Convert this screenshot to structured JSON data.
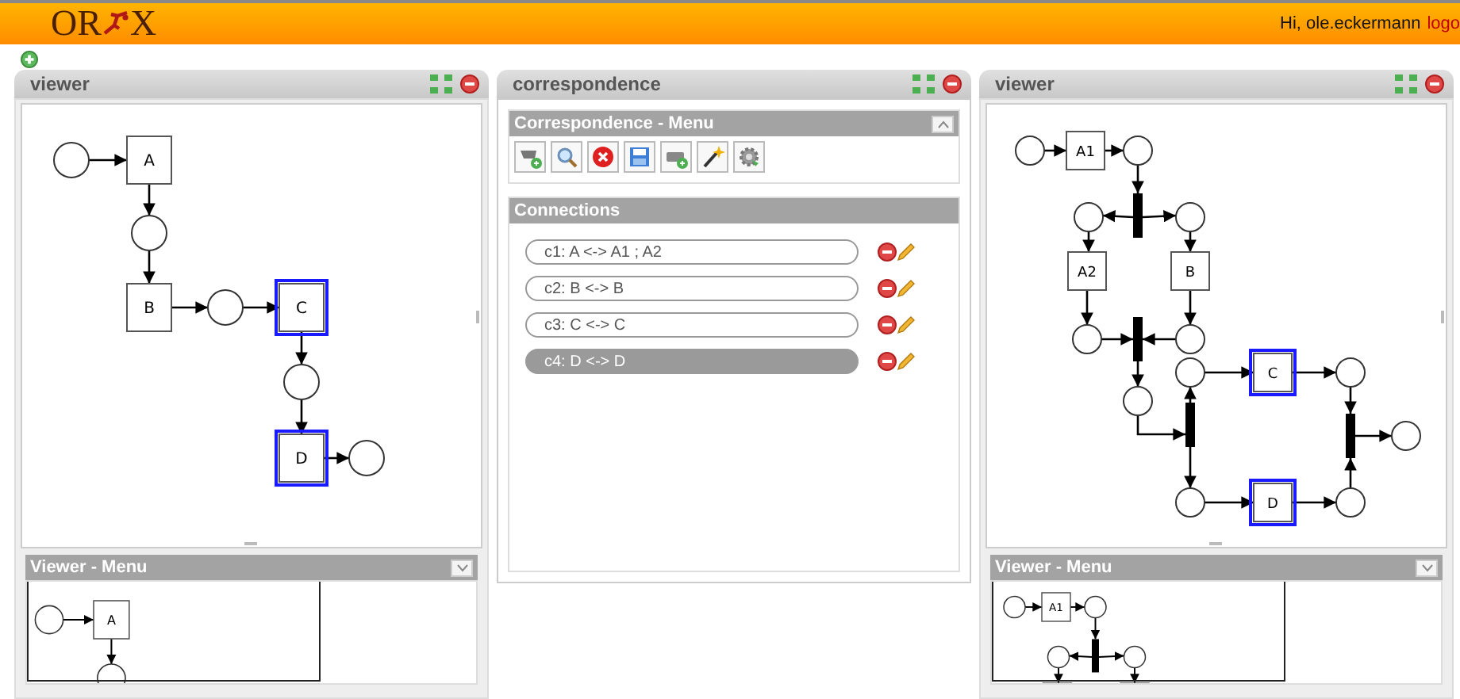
{
  "header": {
    "logo_left": "OR",
    "logo_right": "X",
    "greeting": "Hi, ole.eckermann",
    "logout_link": "logo"
  },
  "panels": [
    {
      "kind": "viewer",
      "title": "viewer",
      "transitions": [
        {
          "label": "A",
          "highlighted": false
        },
        {
          "label": "B",
          "highlighted": false
        },
        {
          "label": "C",
          "highlighted": true
        },
        {
          "label": "D",
          "highlighted": true
        }
      ],
      "menu": {
        "title": "Viewer - Menu",
        "minimap_transitions": [
          {
            "label": "A"
          }
        ]
      }
    },
    {
      "kind": "correspondence",
      "title": "correspondence",
      "menu_title": "Correspondence - Menu",
      "connections_title": "Connections",
      "connections": [
        {
          "label": "c1: A <-> A1 ; A2",
          "selected": false
        },
        {
          "label": "c2: B <-> B",
          "selected": false
        },
        {
          "label": "c3: C <-> C",
          "selected": false
        },
        {
          "label": "c4: D <-> D",
          "selected": true
        }
      ]
    },
    {
      "kind": "viewer",
      "title": "viewer",
      "transitions": [
        {
          "label": "A1",
          "highlighted": false
        },
        {
          "label": "A2",
          "highlighted": false
        },
        {
          "label": "B",
          "highlighted": false
        },
        {
          "label": "C",
          "highlighted": true
        },
        {
          "label": "D",
          "highlighted": true
        }
      ],
      "menu": {
        "title": "Viewer - Menu",
        "minimap_transitions": [
          {
            "label": "A1"
          }
        ]
      }
    }
  ]
}
